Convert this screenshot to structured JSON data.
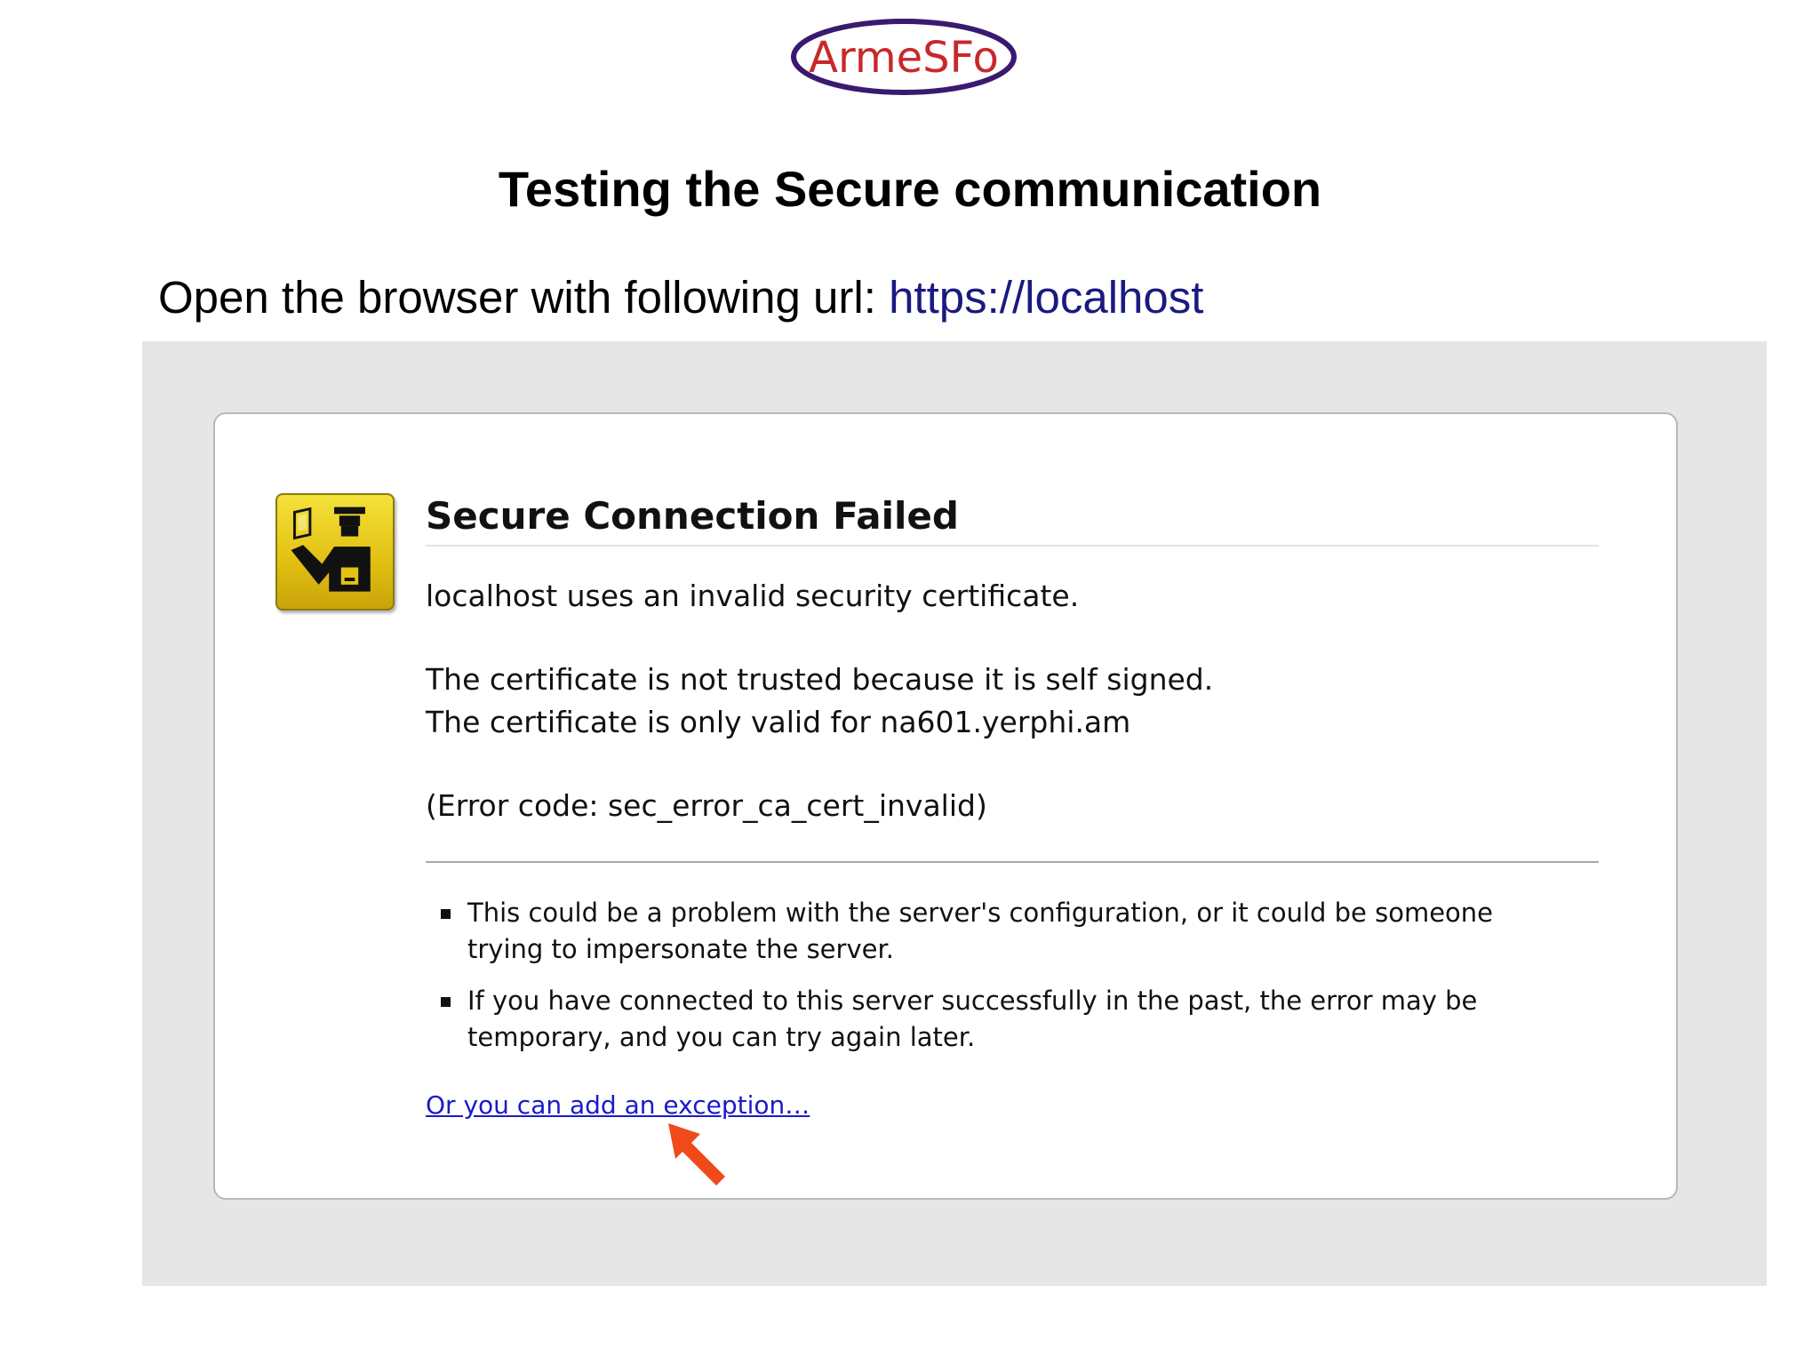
{
  "logo": {
    "text": "ArmeSFo",
    "text_color": "#c8282a",
    "ring_color": "#3a1a70"
  },
  "slide": {
    "title": "Testing the Secure communication",
    "instruction_prefix": "Open the browser with following url: ",
    "instruction_url": "https://localhost",
    "url_color": "#1a1a80"
  },
  "browser_error": {
    "icon": "certificate-officer-icon",
    "title": "Secure Connection Failed",
    "line1": "localhost uses an invalid security certificate.",
    "line2": "The certificate is not trusted because it is self signed.",
    "line3": "The certificate is only valid for na601.yerphi.am",
    "error_code": "(Error code: sec_error_ca_cert_invalid)",
    "bullets": [
      "This could be a problem with the server's configuration, or it could be someone trying to impersonate the server.",
      "If you have connected to this server successfully in the past, the error may be temporary, and you can try again later."
    ],
    "exception_link": "Or you can add an exception…",
    "link_color": "#1a1acc"
  },
  "annotation": {
    "arrow_icon": "red-pointer-arrow-icon",
    "arrow_color": "#f04a1a"
  },
  "colors": {
    "background_gray": "#e6e6e6",
    "icon_yellow": "#e3c214"
  }
}
